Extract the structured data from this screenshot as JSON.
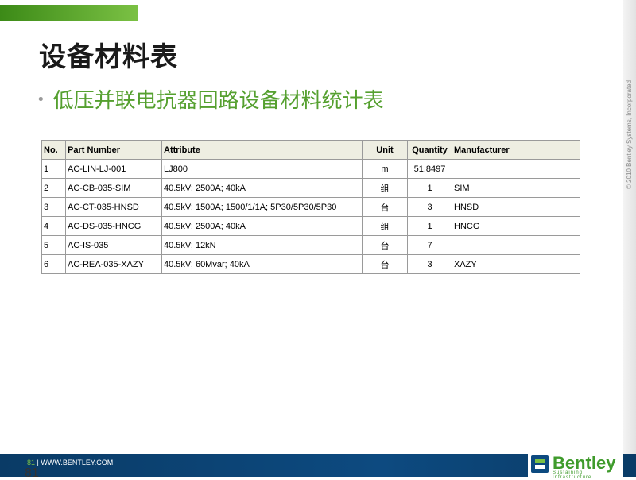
{
  "slide": {
    "title": "设备材料表",
    "bullet": "低压并联电抗器回路设备材料统计表",
    "copyright": "© 2010 Bentley Systems, Incorporated"
  },
  "table": {
    "headers": [
      "No.",
      "Part Number",
      "Attribute",
      "Unit",
      "Quantity",
      "Manufacturer"
    ],
    "rows": [
      [
        "1",
        "AC-LIN-LJ-001",
        "LJ800",
        "m",
        "51.8497",
        ""
      ],
      [
        "2",
        "AC-CB-035-SIM",
        "40.5kV; 2500A; 40kA",
        "组",
        "1",
        "SIM"
      ],
      [
        "3",
        "AC-CT-035-HNSD",
        "40.5kV; 1500A; 1500/1/1A; 5P30/5P30/5P30",
        "台",
        "3",
        "HNSD"
      ],
      [
        "4",
        "AC-DS-035-HNCG",
        "40.5kV; 2500A; 40kA",
        "组",
        "1",
        "HNCG"
      ],
      [
        "5",
        "AC-IS-035",
        "40.5kV; 12kN",
        "台",
        "7",
        ""
      ],
      [
        "6",
        "AC-REA-035-XAZY",
        "40.5kV; 60Mvar; 40kA",
        "台",
        "3",
        "XAZY"
      ]
    ]
  },
  "footer": {
    "page": "81",
    "separator": " | ",
    "url": "WWW.BENTLEY.COM",
    "page_number_large": "81"
  },
  "logo": {
    "name": "Bentley",
    "tagline": "Sustaining Infrastructure"
  },
  "colors": {
    "accent_green": "#55a02f",
    "footer_blue": "#0d4a80",
    "header_fill": "#eeeee2"
  },
  "icons": {
    "logo": "bentley-b-mark-icon"
  }
}
